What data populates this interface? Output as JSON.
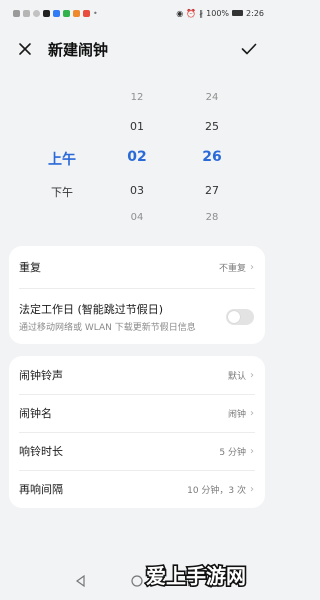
{
  "status_bar": {
    "battery": "100%",
    "time": "2:26"
  },
  "header": {
    "title": "新建闹钟"
  },
  "picker": {
    "ampm": [
      "上午",
      "下午"
    ],
    "ampm_selected": "上午",
    "hours": [
      "12",
      "01",
      "02",
      "03",
      "04"
    ],
    "hour_selected": "02",
    "minutes": [
      "24",
      "25",
      "26",
      "27",
      "28"
    ],
    "minute_selected": "26",
    "accent_color": "#2a6ad8"
  },
  "settings_card1": {
    "repeat": {
      "label": "重复",
      "value": "不重复"
    },
    "holiday": {
      "label": "法定工作日 (智能跳过节假日)",
      "sub": "通过移动网络或 WLAN 下载更新节假日信息",
      "enabled": false
    }
  },
  "settings_card2": {
    "items": [
      {
        "label": "闹钟铃声",
        "value": "默认"
      },
      {
        "label": "闹钟名",
        "value": "闹钟"
      },
      {
        "label": "响铃时长",
        "value": "5 分钟"
      },
      {
        "label": "再响间隔",
        "value": "10 分钟，3 次"
      }
    ]
  },
  "watermark": {
    "text": "爱上手游网"
  }
}
